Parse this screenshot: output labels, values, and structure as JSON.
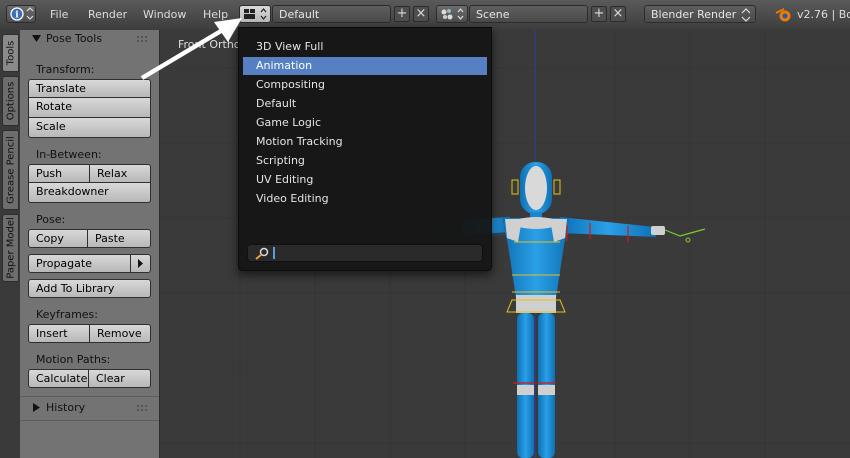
{
  "header": {
    "menus": [
      "File",
      "Render",
      "Window",
      "Help"
    ],
    "screen_layout": "Default",
    "scene": "Scene",
    "render_engine": "Blender Render",
    "version": "v2.76 | Bo"
  },
  "tabs": [
    "Tools",
    "Options",
    "Grease Pencil",
    "Paper Model"
  ],
  "panel": {
    "title": "Pose Tools",
    "transform_label": "Transform:",
    "translate": "Translate",
    "rotate": "Rotate",
    "scale": "Scale",
    "inbetween_label": "In-Between:",
    "push": "Push",
    "relax": "Relax",
    "breakdowner": "Breakdowner",
    "pose_label": "Pose:",
    "copy": "Copy",
    "paste": "Paste",
    "propagate": "Propagate",
    "add_to_library": "Add To Library",
    "keyframes_label": "Keyframes:",
    "insert": "Insert",
    "remove": "Remove",
    "motion_paths_label": "Motion Paths:",
    "calculate": "Calculate",
    "clear": "Clear",
    "history": "History"
  },
  "viewport": {
    "view_label": "Front Ortho"
  },
  "dropdown": {
    "items": [
      "3D View Full",
      "Animation",
      "Compositing",
      "Default",
      "Game Logic",
      "Motion Tracking",
      "Scripting",
      "UV Editing",
      "Video Editing"
    ],
    "selected": "Animation",
    "search_value": ""
  },
  "colors": {
    "highlight": "#5680c2",
    "character_blue": "#1e8fd6",
    "bone_yellow": "#e2c21a"
  }
}
